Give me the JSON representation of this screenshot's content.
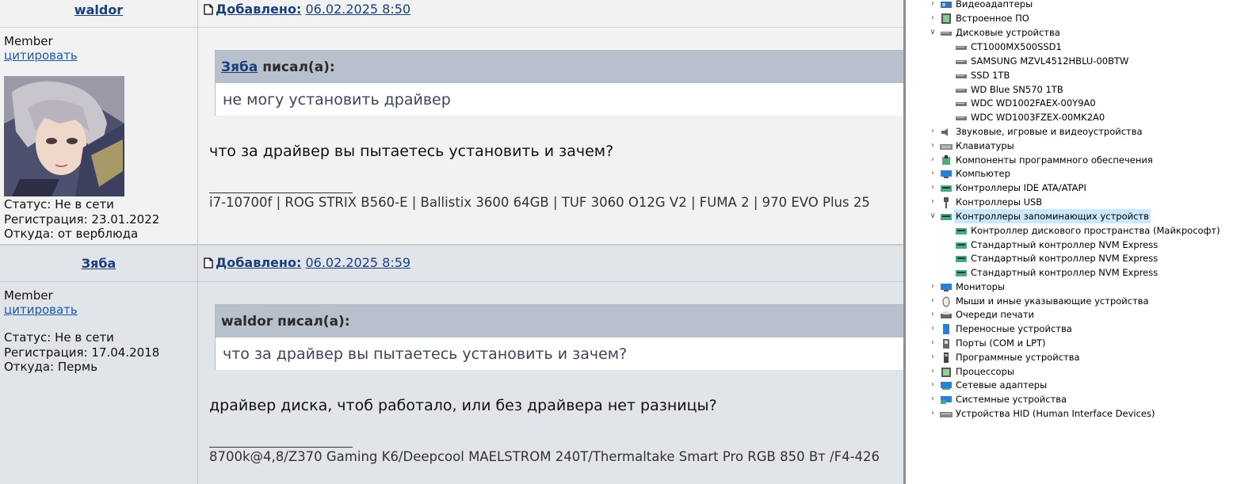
{
  "posts": [
    {
      "username": "waldor",
      "role": "Member",
      "quote_link": "цитировать",
      "status": "Статус: Не в сети",
      "registered": "Регистрация: 23.01.2022",
      "from": "Откуда: от верблюда",
      "added_label": "Добавлено:",
      "added_date": "06.02.2025 8:50",
      "quote_author": "Зяба",
      "quote_suffix": "писал(а):",
      "quote_text": "не могу установить драйвер",
      "message": "что за драйвер вы пытаетесь установить и зачем?",
      "signature": "i7-10700f | ROG STRIX B560-E | Ballistix 3600 64GB | TUF 3060 O12G V2 | FUMA 2 | 970 EVO Plus 25"
    },
    {
      "username": "Зяба",
      "role": "Member",
      "quote_link": "цитировать",
      "status": "Статус: Не в сети",
      "registered": "Регистрация: 17.04.2018",
      "from": "Откуда: Пермь",
      "added_label": "Добавлено:",
      "added_date": "06.02.2025 8:59",
      "quote_header": "waldor писал(а):",
      "quote_text": "что за драйвер вы пытаетесь установить и зачем?",
      "message": "драйвер диска, чтоб работало, или без драйвера нет разницы?",
      "signature": "8700k@4,8/Z370 Gaming K6/Deepcool MAELSTROM 240T/Thermaltake Smart Pro RGB 850 Вт /F4-426"
    }
  ],
  "device_manager": {
    "categories_top": [
      {
        "label": "Видеоадаптеры",
        "icon": "display-adapter-icon"
      },
      {
        "label": "Встроенное ПО",
        "icon": "firmware-icon"
      }
    ],
    "disks": {
      "label": "Дисковые устройства",
      "items": [
        "CT1000MX500SSD1",
        "SAMSUNG MZVL4512HBLU-00BTW",
        "SSD 1TB",
        "WD Blue SN570 1TB",
        "WDC WD1002FAEX-00Y9A0",
        "WDC WD1003FZEX-00MK2A0"
      ]
    },
    "categories_mid": [
      {
        "label": "Звуковые, игровые и видеоустройства",
        "icon": "speaker-icon"
      },
      {
        "label": "Клавиатуры",
        "icon": "keyboard-icon"
      },
      {
        "label": "Компоненты программного обеспечения",
        "icon": "software-component-icon"
      },
      {
        "label": "Компьютер",
        "icon": "computer-icon"
      },
      {
        "label": "Контроллеры IDE ATA/ATAPI",
        "icon": "ide-controller-icon"
      },
      {
        "label": "Контроллеры USB",
        "icon": "usb-icon"
      }
    ],
    "storage_controllers": {
      "label": "Контроллеры запоминающих устройств",
      "items": [
        "Контроллер дискового пространства (Майкрософт)",
        "Стандартный контроллер NVM Express",
        "Стандартный контроллер NVM Express",
        "Стандартный контроллер NVM Express"
      ]
    },
    "categories_bottom": [
      {
        "label": "Мониторы",
        "icon": "monitor-icon"
      },
      {
        "label": "Мыши и иные указывающие устройства",
        "icon": "mouse-icon"
      },
      {
        "label": "Очереди печати",
        "icon": "printer-icon"
      },
      {
        "label": "Переносные устройства",
        "icon": "portable-device-icon"
      },
      {
        "label": "Порты (COM и LPT)",
        "icon": "port-icon"
      },
      {
        "label": "Программные устройства",
        "icon": "software-device-icon"
      },
      {
        "label": "Процессоры",
        "icon": "processor-icon"
      },
      {
        "label": "Сетевые адаптеры",
        "icon": "network-adapter-icon"
      },
      {
        "label": "Системные устройства",
        "icon": "system-device-icon"
      },
      {
        "label": "Устройства HID (Human Interface Devices)",
        "icon": "hid-icon"
      }
    ]
  }
}
